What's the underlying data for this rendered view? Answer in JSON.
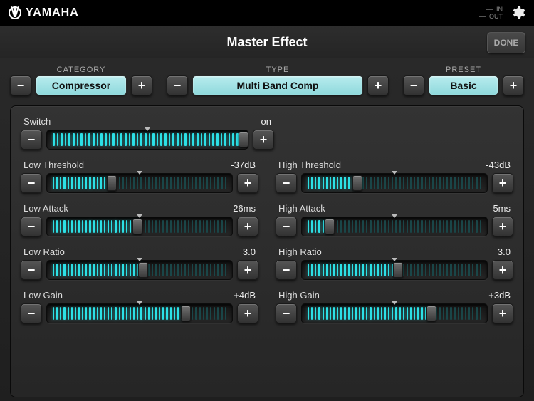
{
  "header": {
    "brand": "YAMAHA",
    "title": "Master Effect",
    "done_label": "DONE",
    "io_in": "IN",
    "io_out": "OUT"
  },
  "selectors": {
    "category": {
      "label": "CATEGORY",
      "value": "Compressor"
    },
    "type": {
      "label": "TYPE",
      "value": "Multi Band Comp"
    },
    "preset": {
      "label": "PRESET",
      "value": "Basic"
    }
  },
  "params": [
    {
      "id": "switch",
      "label": "Switch",
      "value": "on",
      "fill": 100,
      "marker": 50,
      "full": true
    },
    {
      "id": "low-threshold",
      "label": "Low Threshold",
      "value": "-37dB",
      "fill": 35,
      "marker": 50
    },
    {
      "id": "high-threshold",
      "label": "High Threshold",
      "value": "-43dB",
      "fill": 30,
      "marker": 50
    },
    {
      "id": "low-attack",
      "label": "Low Attack",
      "value": "26ms",
      "fill": 49,
      "marker": 50
    },
    {
      "id": "high-attack",
      "label": "High Attack",
      "value": "5ms",
      "fill": 15,
      "marker": 50
    },
    {
      "id": "low-ratio",
      "label": "Low Ratio",
      "value": "3.0",
      "fill": 52,
      "marker": 50
    },
    {
      "id": "high-ratio",
      "label": "High Ratio",
      "value": "3.0",
      "fill": 52,
      "marker": 50
    },
    {
      "id": "low-gain",
      "label": "Low Gain",
      "value": "+4dB",
      "fill": 75,
      "marker": 50
    },
    {
      "id": "high-gain",
      "label": "High Gain",
      "value": "+3dB",
      "fill": 70,
      "marker": 50
    }
  ],
  "icons": {
    "minus": "−",
    "plus": "+"
  }
}
